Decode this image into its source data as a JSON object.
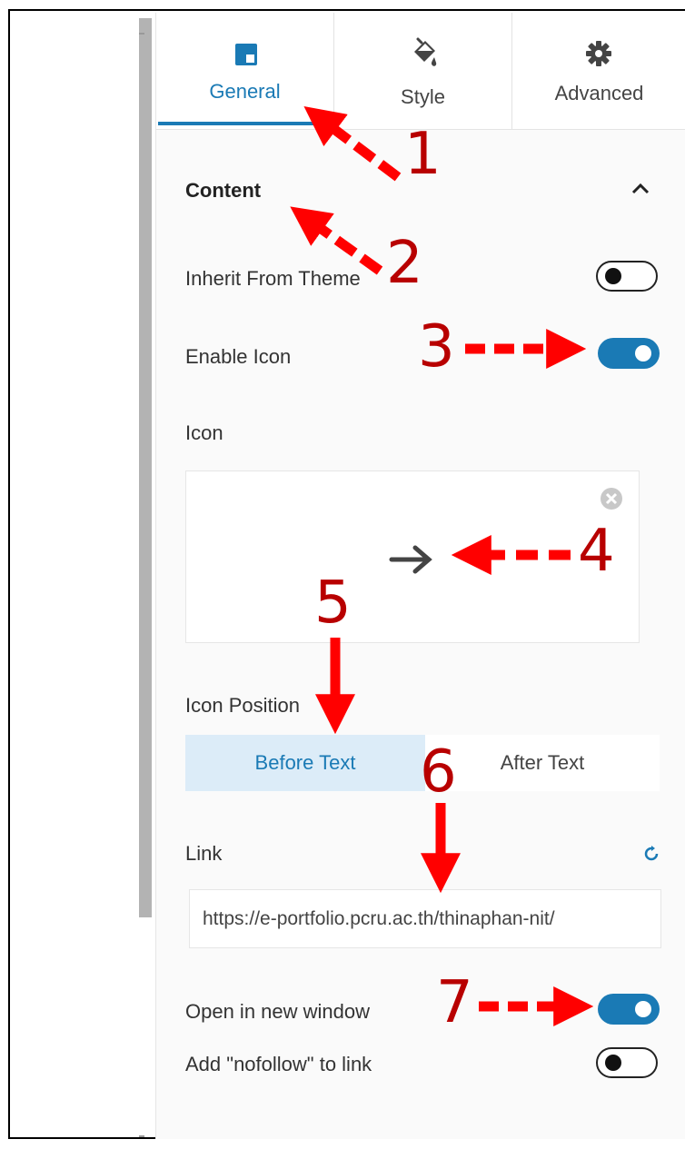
{
  "tabs": [
    {
      "label": "General",
      "icon": "layout-icon"
    },
    {
      "label": "Style",
      "icon": "paint-bucket-icon"
    },
    {
      "label": "Advanced",
      "icon": "gear-icon"
    }
  ],
  "section": {
    "title": "Content",
    "collapse_icon": "chevron-up-icon"
  },
  "fields": {
    "inherit_theme": {
      "label": "Inherit From Theme",
      "state": "off"
    },
    "enable_icon": {
      "label": "Enable Icon",
      "state": "on"
    },
    "icon": {
      "label": "Icon",
      "selected_icon": "arrow-right-icon"
    },
    "icon_position": {
      "label": "Icon Position",
      "options": [
        "Before Text",
        "After Text"
      ],
      "selected": "Before Text"
    },
    "link": {
      "label": "Link",
      "value": "https://e-portfolio.pcru.ac.th/thinaphan-nit/",
      "reset_icon": "reset-icon"
    },
    "open_new_window": {
      "label": "Open in new window",
      "state": "on"
    },
    "nofollow": {
      "label": "Add \"nofollow\" to link",
      "state": "off"
    }
  },
  "annotations": [
    "1",
    "2",
    "3",
    "4",
    "5",
    "6",
    "7"
  ],
  "colors": {
    "accent": "#1a7ab5",
    "annotation": "#b80000",
    "arrow": "#ff0000"
  }
}
